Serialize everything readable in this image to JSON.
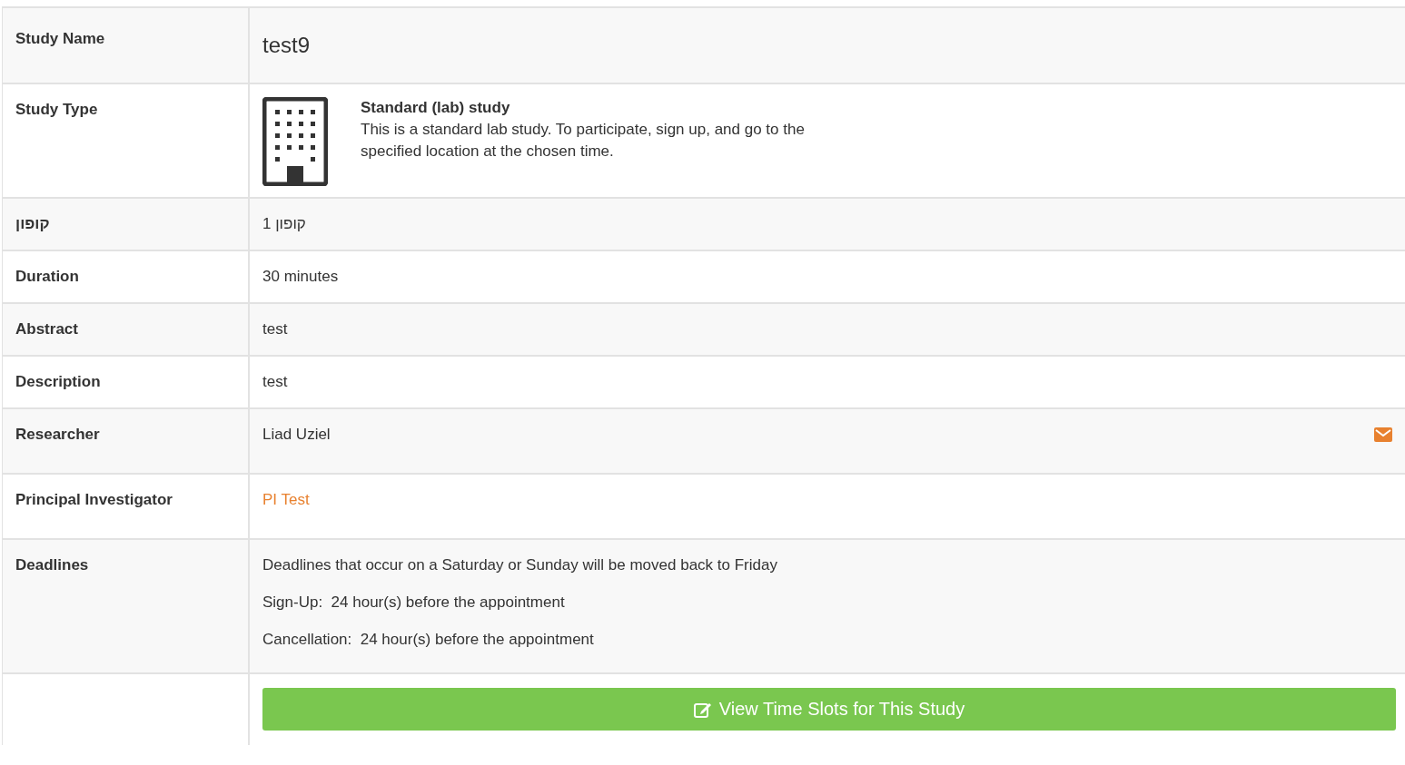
{
  "rows": [
    {
      "kind": "title",
      "label": "Study Name",
      "value": "test9"
    },
    {
      "kind": "study_type",
      "label": "Study Type",
      "type_name": "Standard (lab) study",
      "description": "This is a standard lab study. To participate, sign up, and go to the specified location at the chosen time."
    },
    {
      "kind": "text",
      "label": "קופון",
      "value": "1 קופון"
    },
    {
      "kind": "text",
      "label": "Duration",
      "value": "30 minutes"
    },
    {
      "kind": "text",
      "label": "Abstract",
      "value": "test"
    },
    {
      "kind": "text",
      "label": "Description",
      "value": "test"
    },
    {
      "kind": "contact",
      "label": "Researcher",
      "value": "Liad Uziel"
    },
    {
      "kind": "link",
      "label": "Principal Investigator",
      "value": "PI Test"
    },
    {
      "kind": "lines",
      "label": "Deadlines",
      "lines": [
        "Deadlines that occur on a Saturday or Sunday will be moved back to Friday",
        "Sign-Up:  24 hour(s) before the appointment",
        "Cancellation:  24 hour(s) before the appointment"
      ]
    },
    {
      "kind": "action",
      "button": "View Time Slots for This Study"
    }
  ]
}
